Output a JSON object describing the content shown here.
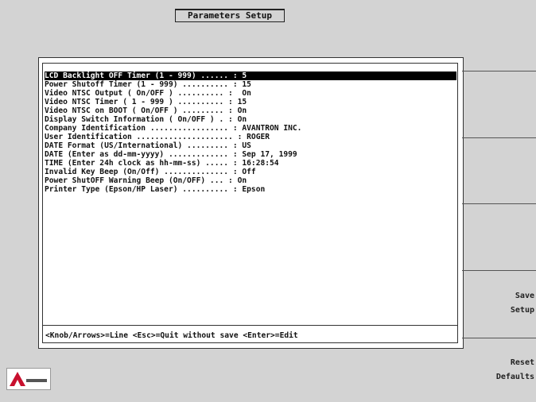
{
  "title": "Parameters Setup",
  "rows": [
    {
      "text": "LCD Backlight OFF Timer (1 - 999) ...... : 5",
      "selected": true
    },
    {
      "text": "Power Shutoff Timer (1 - 999) .......... : 15"
    },
    {
      "text": "Video NTSC Output ( On/OFF ) .......... :  On"
    },
    {
      "text": "Video NTSC Timer ( 1 - 999 ) .......... : 15"
    },
    {
      "text": "Video NTSC on BOOT ( On/OFF ) ......... : On"
    },
    {
      "text": "Display Switch Information ( On/OFF ) . : On"
    },
    {
      "text": "Company Identification ................. : AVANTRON INC."
    },
    {
      "text": "User Identification ..................... : ROGER"
    },
    {
      "text": "DATE Format (US/International) ......... : US"
    },
    {
      "text": "DATE (Enter as dd-mm-yyyy) ............. : Sep 17, 1999"
    },
    {
      "text": "TIME (Enter 24h clock as hh-mm-ss) ..... : 16:28:54"
    },
    {
      "text": "Invalid Key Beep (On/Off) .............. : Off"
    },
    {
      "text": "Power ShutOFF Warning Beep (On/OFF) ... : On"
    },
    {
      "text": "Printer Type (Epson/HP Laser) .......... : Epson"
    }
  ],
  "hint": "<Knob/Arrows>=Line <Esc>=Quit without save <Enter>=Edit",
  "softkeys": {
    "save_line1": "Save",
    "save_line2": "Setup",
    "reset_line1": "Reset",
    "reset_line2": "Defaults"
  },
  "logo_icon": "avantron-logo-icon"
}
